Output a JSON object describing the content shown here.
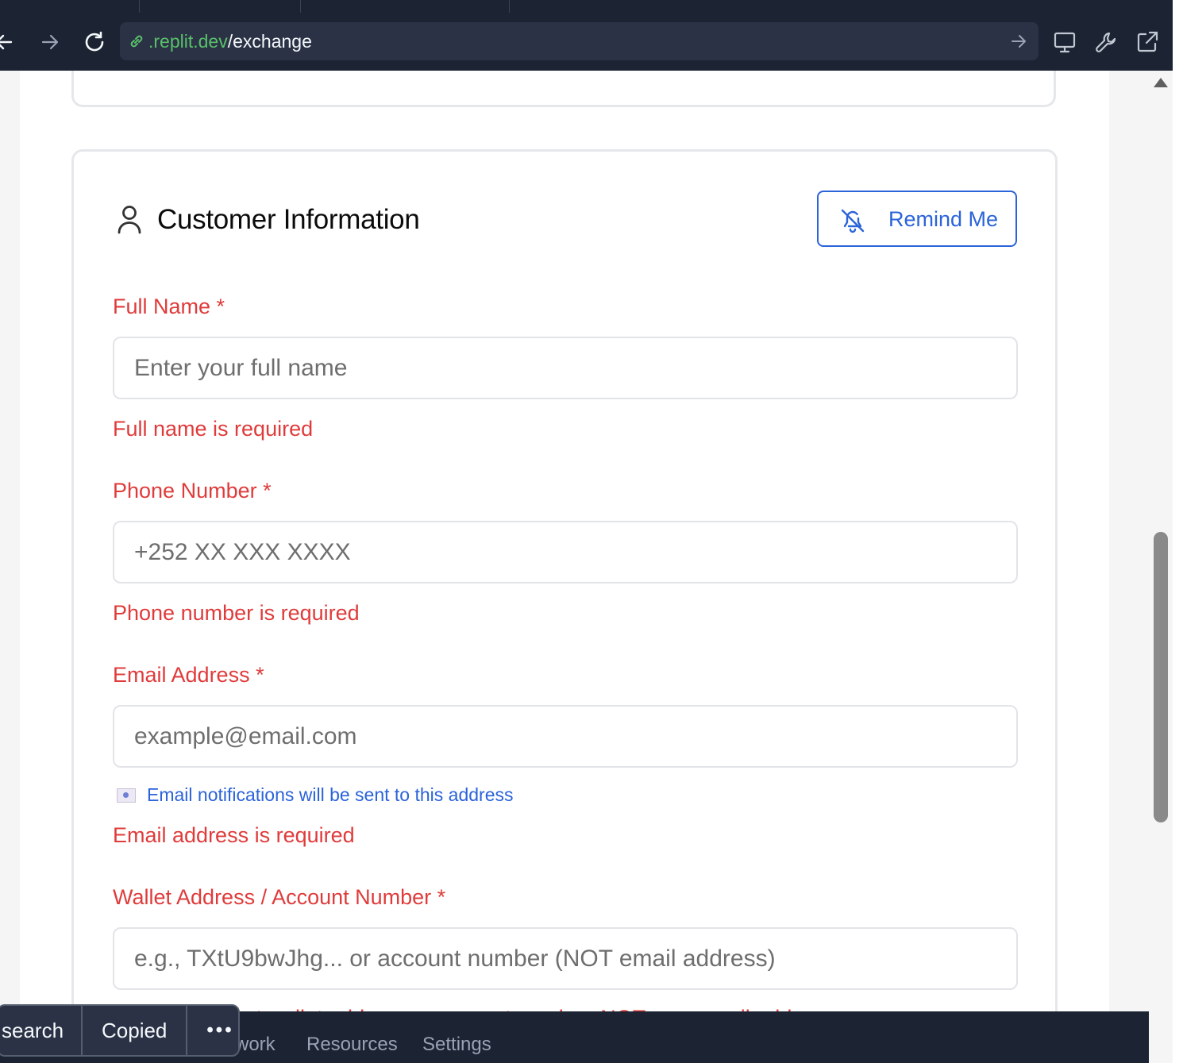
{
  "browser": {
    "url_host": ".replit.dev",
    "url_path": "/exchange"
  },
  "card": {
    "title": "Customer Information",
    "remind_label": "Remind Me"
  },
  "form": {
    "full_name": {
      "label": "Full Name *",
      "placeholder": "Enter your full name",
      "error": "Full name is required"
    },
    "phone": {
      "label": "Phone Number *",
      "placeholder": "+252 XX XXX XXXX",
      "error": "Phone number is required"
    },
    "email": {
      "label": "Email Address *",
      "placeholder": "example@email.com",
      "hint": "Email notifications will be sent to this address",
      "error": "Email address is required"
    },
    "wallet": {
      "label": "Wallet Address / Account Number *",
      "placeholder": "e.g., TXtU9bwJhg... or account number (NOT email address)",
      "error_partial": "...t wallet address or account number, NOT your email address"
    }
  },
  "bottom_bar": {
    "items": [
      "work",
      "Resources",
      "Settings"
    ]
  },
  "toast": {
    "search_label": "search",
    "copied_label": "Copied",
    "more_label": "•••"
  }
}
